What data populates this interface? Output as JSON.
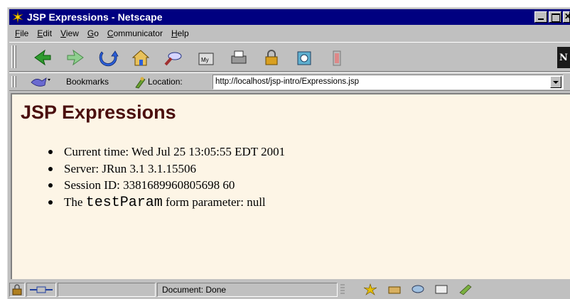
{
  "window": {
    "title": "JSP Expressions - Netscape",
    "title_bar_color": "#000080",
    "chrome_color": "#c0c0c0"
  },
  "menubar": {
    "items": [
      {
        "first": "F",
        "rest": "ile"
      },
      {
        "first": "E",
        "rest": "dit"
      },
      {
        "first": "V",
        "rest": "iew"
      },
      {
        "first": "G",
        "rest": "o"
      },
      {
        "first": "C",
        "rest": "ommunicator"
      },
      {
        "first": "H",
        "rest": "elp"
      }
    ]
  },
  "nav_toolbar": {
    "icons": [
      "back-icon",
      "forward-icon",
      "reload-icon",
      "home-icon",
      "search-icon",
      "my-netscape-icon",
      "print-icon",
      "security-icon",
      "shop-icon",
      "stop-icon"
    ]
  },
  "location_toolbar": {
    "bookmarks_label": "Bookmarks",
    "location_label": "Location:",
    "url": "http://localhost/jsp-intro/Expressions.jsp"
  },
  "content": {
    "background": "#fdf5e6",
    "title": "JSP Expressions",
    "title_color": "#4b0f0f",
    "items": {
      "current_time": "Current time: Wed Jul 25 13:05:55 EDT 2001",
      "server": "Server: JRun 3.1 3.1.15506",
      "session_id": "Session ID: 3381689960805698 60",
      "param_prefix": "The",
      "param_code": "testParam",
      "param_suffix": "form parameter: null"
    }
  },
  "statusbar": {
    "status_text": "Document: Done"
  }
}
